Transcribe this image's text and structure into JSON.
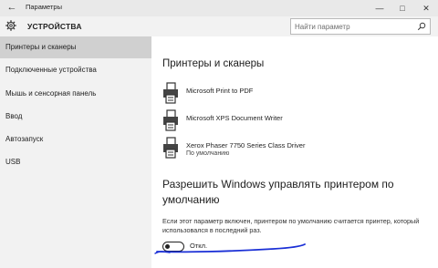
{
  "window": {
    "title": "Параметры",
    "back_icon": "arrow-left-icon",
    "controls": [
      "minimize-icon",
      "maximize-icon",
      "close-icon"
    ]
  },
  "header": {
    "app_title": "УСТРОЙСТВА",
    "icon": "gear-icon",
    "search_placeholder": "Найти параметр"
  },
  "sidebar": {
    "items": [
      {
        "label": "Принтеры и сканеры",
        "active": true
      },
      {
        "label": "Подключенные устройства",
        "active": false
      },
      {
        "label": "Мышь и сенсорная панель",
        "active": false
      },
      {
        "label": "Ввод",
        "active": false
      },
      {
        "label": "Автозапуск",
        "active": false
      },
      {
        "label": "USB",
        "active": false
      }
    ]
  },
  "main": {
    "title": "Принтеры и сканеры",
    "printers": [
      {
        "name": "Microsoft Print to PDF",
        "status": ""
      },
      {
        "name": "Microsoft XPS Document Writer",
        "status": ""
      },
      {
        "name": "Xerox Phaser 7750 Series Class Driver",
        "status": "По умолчанию"
      }
    ],
    "setting_title": "Разрешить Windows управлять принтером по умолчанию",
    "setting_description": "Если этот параметр включен, принтером по умолчанию считается принтер, который использовался в последний раз.",
    "toggle_state": "Откл.",
    "toggle_on": false,
    "annotation_color": "#1a2fd6"
  },
  "colors": {
    "sidebar_bg": "#f2f2f2",
    "active_item": "#d0d0d0",
    "titlebar_bg": "#e9e9e9"
  }
}
